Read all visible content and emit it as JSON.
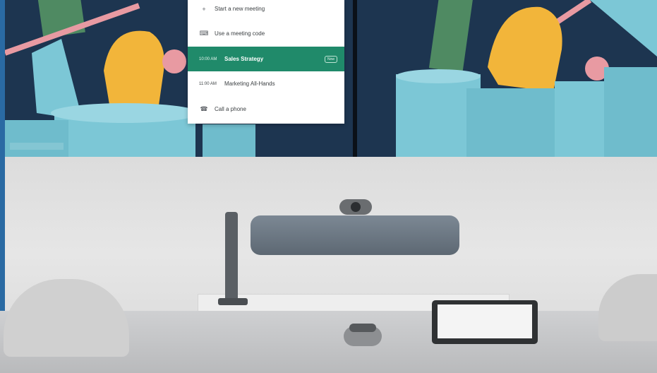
{
  "meeting_menu": {
    "items": [
      {
        "icon": "plus-icon",
        "label": "Start a new meeting"
      },
      {
        "icon": "keyboard-icon",
        "label": "Use a meeting code"
      },
      {
        "time": "10:00 AM",
        "label": "Sales Strategy",
        "badge": "Now",
        "active": true
      },
      {
        "time": "11:00 AM",
        "label": "Marketing All-Hands"
      },
      {
        "icon": "phone-icon",
        "label": "Call a phone"
      }
    ]
  },
  "colors": {
    "menu_active": "#208a6a",
    "wall": "#dedede",
    "soundbar": "#6b7682",
    "shape_yellow": "#f2b53a",
    "shape_blue": "#7cc7d6",
    "shape_pink": "#e89aa2",
    "shape_green": "#4f8a62",
    "screen_bg": "#1d3550"
  }
}
